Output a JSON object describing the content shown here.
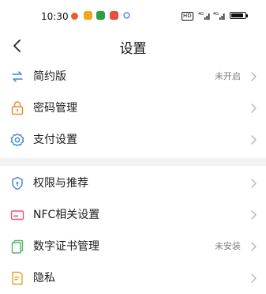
{
  "status_bar": {
    "time": "10:30",
    "hd_label": "HD",
    "signal_label": "4G",
    "signal_label_2": "4G"
  },
  "header": {
    "title": "设置"
  },
  "colors": {
    "icon_blue": "#3d84d6",
    "icon_orange": "#ef8a2b",
    "icon_red": "#e4566c",
    "icon_green": "#55b36a",
    "icon_yellow": "#e6a22b",
    "separator_bg": "#f2f2f2"
  },
  "group1": [
    {
      "label": "简约版",
      "value": "未开启",
      "icon": "swap-arrows-icon"
    },
    {
      "label": "密码管理",
      "value": "",
      "icon": "lock-icon"
    },
    {
      "label": "支付设置",
      "value": "",
      "icon": "gear-icon"
    }
  ],
  "group2": [
    {
      "label": "权限与推荐",
      "value": "",
      "icon": "shield-icon"
    },
    {
      "label": "NFC相关设置",
      "value": "",
      "icon": "nfc-card-icon"
    },
    {
      "label": "数字证书管理",
      "value": "未安装",
      "icon": "certificate-icon"
    },
    {
      "label": "隐私",
      "value": "",
      "icon": "privacy-doc-icon"
    }
  ]
}
